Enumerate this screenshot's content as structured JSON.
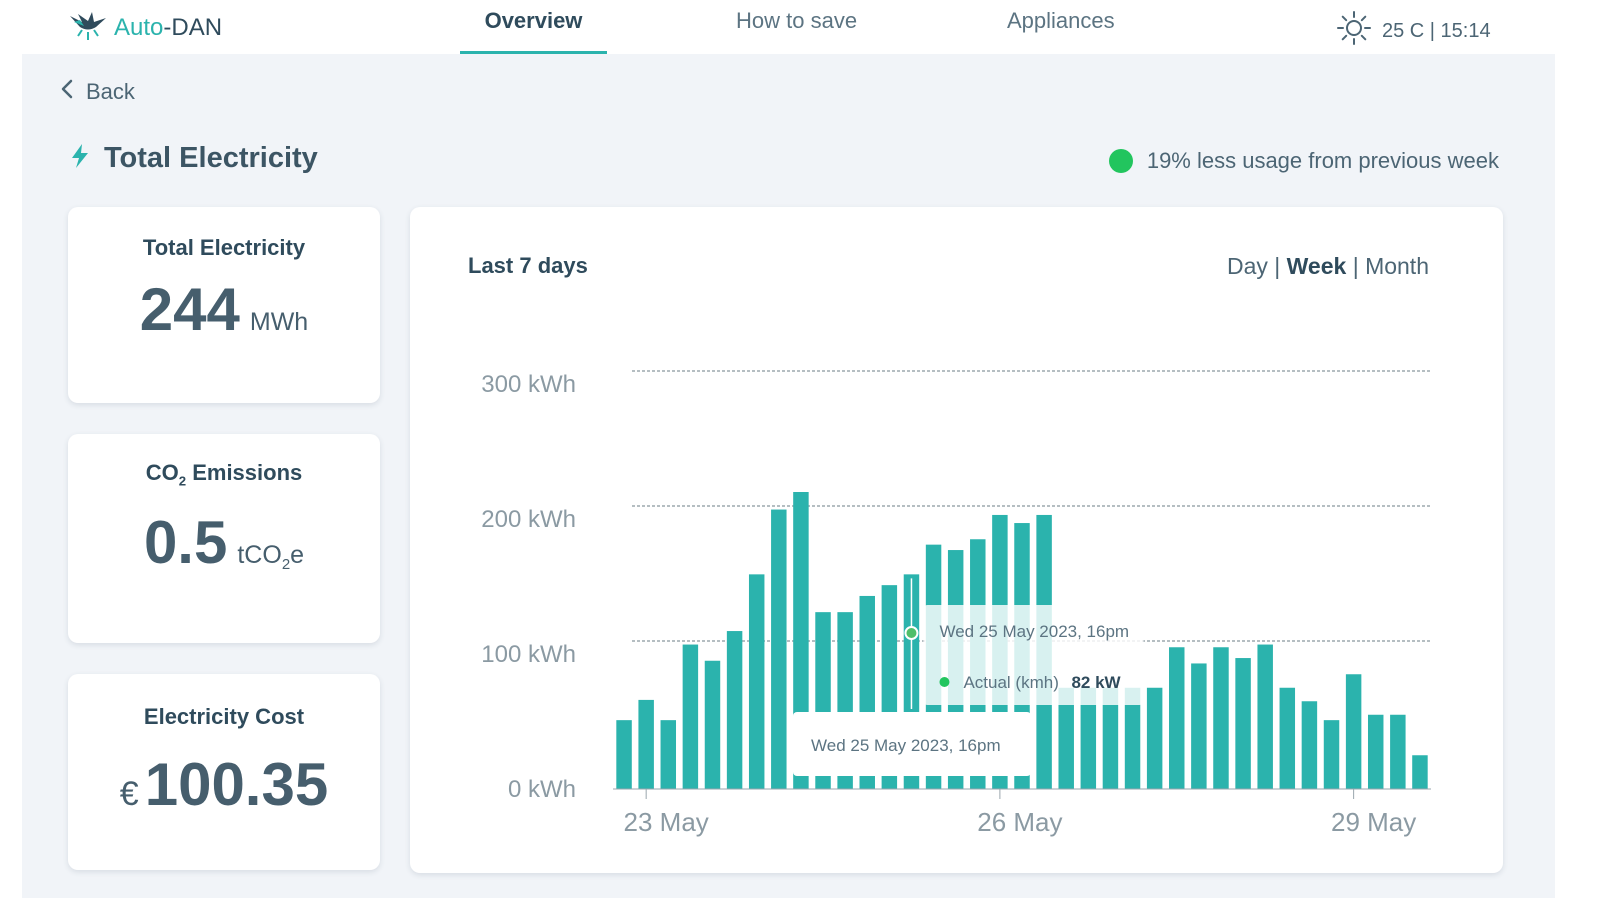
{
  "app": {
    "brand_part1": "Auto",
    "brand_part2": "-DAN",
    "logo_icon": "bird-icon"
  },
  "nav": {
    "tabs": [
      {
        "label": "Overview",
        "active": true
      },
      {
        "label": "How to save",
        "active": false
      },
      {
        "label": "Appliances",
        "active": false
      }
    ]
  },
  "weather": {
    "icon": "sun-icon",
    "text": "25 C | 15:14"
  },
  "back_label": "Back",
  "page_title": "Total Electricity",
  "status": {
    "text": "19% less usage from previous week",
    "color": "#22c55e"
  },
  "cards": {
    "total": {
      "title": "Total Electricity",
      "value": "244",
      "unit": "MWh"
    },
    "co2": {
      "title_pre": "CO",
      "title_sub": "2",
      "title_post": " Emissions",
      "value": "0.5",
      "unit_pre": "tCO",
      "unit_sub": "2",
      "unit_post": "e"
    },
    "cost": {
      "title": "Electricity Cost",
      "currency": "€",
      "value": "100.35"
    }
  },
  "chart_header": {
    "title": "Last 7 days",
    "ranges": [
      "Day",
      "Week",
      "Month"
    ],
    "active_range": "Week"
  },
  "chart_data": {
    "type": "bar",
    "ylabel": "",
    "xlabel": "",
    "ylim": [
      0,
      300
    ],
    "y_ticks": [
      "0 kWh",
      "100 kWh",
      "200 kWh",
      "300 kWh"
    ],
    "y_tick_values": [
      0,
      100,
      200,
      300
    ],
    "x_ticks": [
      {
        "label": "23 May",
        "index": 1
      },
      {
        "label": "26 May",
        "index": 17
      },
      {
        "label": "29 May",
        "index": 33
      }
    ],
    "bar_color": "#2bb3ad",
    "values": [
      51,
      66,
      51,
      107,
      95,
      117,
      159,
      207,
      220,
      131,
      131,
      143,
      151,
      159,
      181,
      177,
      185,
      203,
      197,
      203,
      75,
      75,
      75,
      75,
      75,
      105,
      93,
      105,
      97,
      107,
      75,
      65,
      51,
      85,
      55,
      55,
      25
    ],
    "tooltips": [
      {
        "date": "Wed  25 May 2023, 16pm",
        "series": "Actual (kmh)",
        "value": "82 kW"
      },
      {
        "date": "Wed  25 May 2023, 16pm"
      }
    ]
  }
}
